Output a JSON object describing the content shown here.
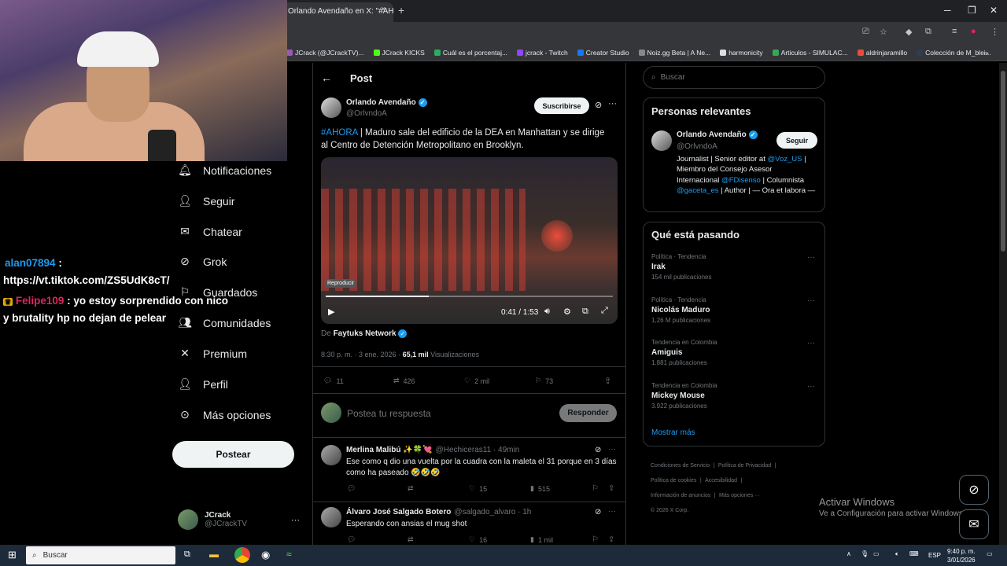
{
  "browser": {
    "tab_title": "Orlando Avendaño en X: \"#AHORA",
    "tab_close": "×",
    "new_tab": "+",
    "bookmarks": [
      {
        "label": "JCrack (@JCrackTV)...",
        "color": "#9b59b6"
      },
      {
        "label": "JCrack KICKS",
        "color": "#53fc18"
      },
      {
        "label": "Cuál es el porcentaj...",
        "color": "#27ae60"
      },
      {
        "label": "jcrack - Twitch",
        "color": "#9146ff"
      },
      {
        "label": "Creator Studio",
        "color": "#1877f2"
      },
      {
        "label": "Noiz.gg Beta | A Ne...",
        "color": "#888888"
      },
      {
        "label": "harmonicity",
        "color": "#dddddd"
      },
      {
        "label": "Articulos - SIMULAC...",
        "color": "#34a853"
      },
      {
        "label": "aldrinjaramillo",
        "color": "#e74c3c"
      },
      {
        "label": "Colección de M_blei...",
        "color": "#2c3e50"
      }
    ],
    "bookmarks_more": "»"
  },
  "chat": [
    {
      "user": "alan07894",
      "user_color": "#1d9bf0",
      "sep": ":",
      "text": "https://vt.tiktok.com/ZS5UdK8cT/"
    },
    {
      "user": "Felipe109",
      "user_color": "#e0245e",
      "sep": ":",
      "text": "yo estoy sorprendido con nico",
      "text2": "y brutality hp no dejan de pelear"
    }
  ],
  "nav": {
    "items": [
      {
        "label": "Notificaciones",
        "icon": "bell-icon"
      },
      {
        "label": "Seguir",
        "icon": "person-add-icon"
      },
      {
        "label": "Chatear",
        "icon": "mail-icon"
      },
      {
        "label": "Grok",
        "icon": "grok-icon"
      },
      {
        "label": "Guardados",
        "icon": "bookmark-icon"
      },
      {
        "label": "Comunidades",
        "icon": "people-icon"
      },
      {
        "label": "Premium",
        "icon": "x-logo-icon"
      },
      {
        "label": "Perfil",
        "icon": "person-icon"
      },
      {
        "label": "Más opciones",
        "icon": "more-circle-icon"
      }
    ],
    "post_button": "Postear",
    "account": {
      "name": "JCrack",
      "handle": "@JCrackTV",
      "more": "···"
    }
  },
  "post": {
    "header_title": "Post",
    "author_name": "Orlando Avendaño",
    "author_handle": "@OrlvndoA",
    "subscribe_label": "Suscribirse",
    "more": "···",
    "hashtag": "#AHORA",
    "text": " | Maduro sale del edificio de la DEA en Manhattan y se dirige al Centro de Detención Metropolitano en Brooklyn.",
    "video": {
      "tooltip": "Reproducir",
      "time": "0:41 / 1:53",
      "progress": 0.358
    },
    "source_prefix": "De",
    "source_name": "Faytuks Network",
    "time": "8:30 p. m. · 3 ene. 2026 ·",
    "views_count": "65,1 mil",
    "views_label": "Visualizaciones",
    "stats": {
      "replies": "11",
      "reposts": "426",
      "likes": "2 mil",
      "bookmarks": "73"
    },
    "reply_placeholder": "Postea tu respuesta",
    "reply_button": "Responder"
  },
  "replies": [
    {
      "name": "Merlina Malibú ✨🍀💘",
      "handle": "@Hechiceras11 · 49min",
      "text": "Ese como q dio una vuelta por la cuadra con la maleta el 31 porque en 3 días como ha paseado 🤣🤣🤣",
      "likes": "15",
      "views": "515",
      "more": "···"
    },
    {
      "name": "Álvaro José Salgado Botero",
      "handle": "@salgado_alvaro · 1h",
      "text": "Esperando con ansias el mug shot",
      "likes": "16",
      "views": "1 mil",
      "more": "···"
    }
  ],
  "sidebar": {
    "search_placeholder": "Buscar",
    "relevant_title": "Personas relevantes",
    "relevant": {
      "name": "Orlando Avendaño",
      "handle": "@OrlvndoA",
      "follow_label": "Seguir",
      "bio_1": "Journalist | Senior editor at ",
      "bio_link1": "@Voz_US",
      "bio_2": " | Miembro del Consejo Asesor Internacional ",
      "bio_link2": "@FDisenso",
      "bio_3": " | Columnista ",
      "bio_link3": "@gaceta_es",
      "bio_4": " | Author | — Ora et labora —"
    },
    "trends_title": "Qué está pasando",
    "trends": [
      {
        "meta": "Política · Tendencia",
        "name": "Irak",
        "count": "154 mil publicaciones"
      },
      {
        "meta": "Política · Tendencia",
        "name": "Nicolás Maduro",
        "count": "1,26 M publicaciones"
      },
      {
        "meta": "Tendencia en Colombia",
        "name": "Amiguis",
        "count": "1.881 publicaciones"
      },
      {
        "meta": "Tendencia en Colombia",
        "name": "Mickey Mouse",
        "count": "3.922 publicaciones"
      }
    ],
    "trends_more": "···",
    "show_more": "Mostrar más",
    "footer": {
      "l1": "Condiciones de Servicio",
      "l2": "Política de Privacidad",
      "l3": "Política de cookies",
      "l4": "Accesibilidad",
      "l5": "Información de anuncios",
      "l6": "Más opciones ···",
      "l7": "© 2026 X Corp.",
      "bar": "|"
    }
  },
  "windows": {
    "activate_title": "Activar Windows",
    "activate_sub": "Ve a Configuración para activar Windows.",
    "search_label": "Buscar",
    "lang": "ESP",
    "time": "9:40 p. m.",
    "date": "3/01/2026"
  }
}
